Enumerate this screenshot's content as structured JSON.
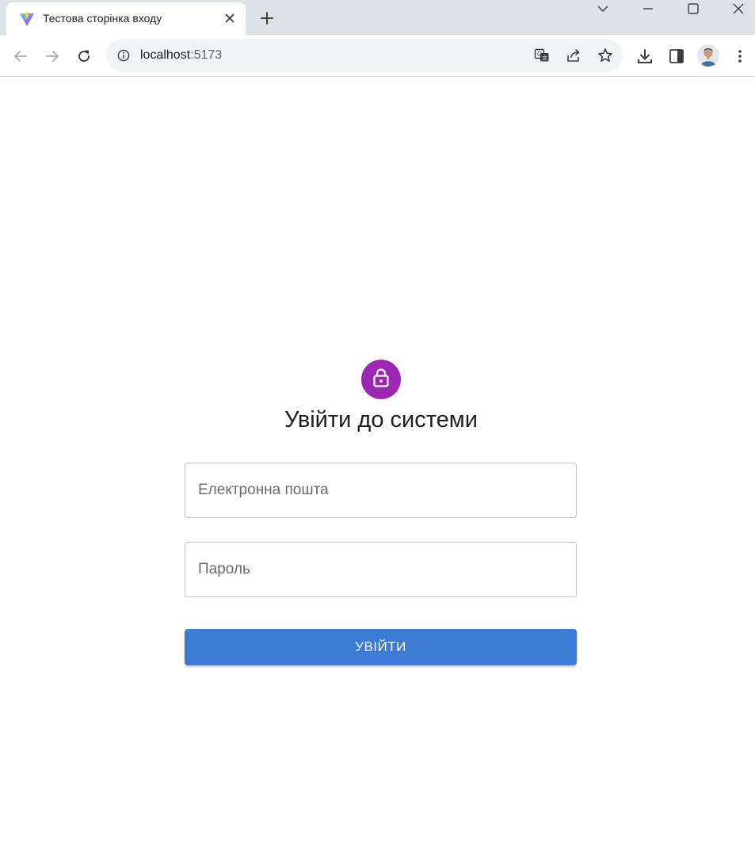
{
  "browser": {
    "tab": {
      "title": "Тестова сторінка входу",
      "favicon": "vite-logo-icon"
    },
    "url_host": "localhost",
    "url_port": ":5173",
    "toolbar_icons": [
      "back-icon",
      "forward-icon",
      "reload-icon",
      "info-icon",
      "translate-icon",
      "share-icon",
      "bookmark-star-icon",
      "download-icon",
      "side-panel-icon",
      "avatar",
      "menu-kebab-icon"
    ]
  },
  "login": {
    "icon": "lock-icon",
    "title": "Увійти до системи",
    "email_placeholder": "Електронна пошта",
    "email_value": "",
    "password_placeholder": "Пароль",
    "password_value": "",
    "submit_label": "УВІЙТИ"
  },
  "colors": {
    "accent_purple": "#9c27b0",
    "button_blue": "#3c7bd5",
    "tabstrip": "#dee1e6",
    "omnibox": "#f1f3f4"
  }
}
